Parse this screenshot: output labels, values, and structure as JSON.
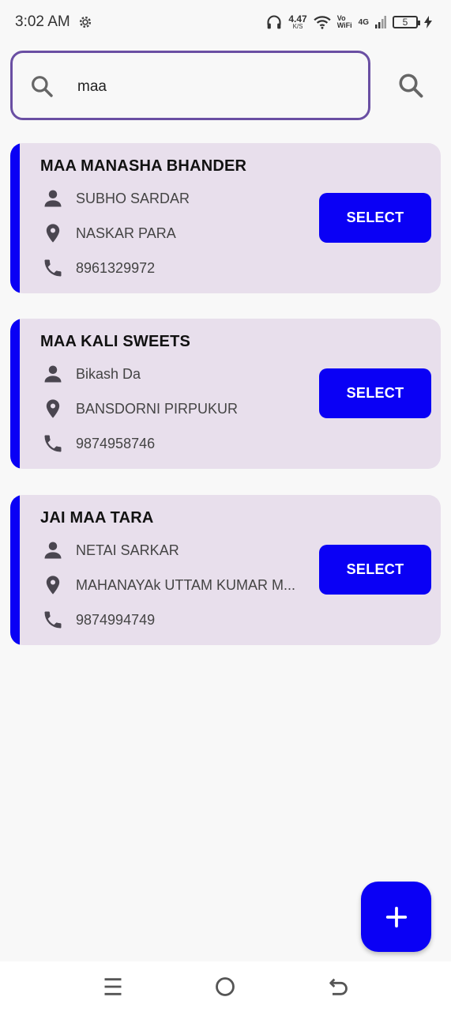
{
  "status_bar": {
    "time": "3:02 AM",
    "net_speed": "4.47",
    "net_speed_unit": "K/S",
    "vo": "Vo",
    "wifi": "WiFi",
    "network": "4G",
    "battery": "5"
  },
  "search": {
    "value": "maa",
    "placeholder": ""
  },
  "shops": [
    {
      "name": "MAA MANASHA BHANDER",
      "owner": "SUBHO SARDAR",
      "address": "NASKAR PARA",
      "phone": "8961329972",
      "select_label": "SELECT"
    },
    {
      "name": "MAA KALI SWEETS",
      "owner": "Bikash Da",
      "address": "BANSDORNI PIRPUKUR",
      "phone": "9874958746",
      "select_label": "SELECT"
    },
    {
      "name": "JAI MAA TARA",
      "owner": "NETAI SARKAR",
      "address": "MAHANAYAk UTTAM KUMAR M...",
      "phone": "9874994749",
      "select_label": "SELECT"
    }
  ],
  "colors": {
    "accent": "#0a00f5",
    "card_bg": "#e8dfec",
    "search_border": "#6a4fa3"
  },
  "icons": {
    "status": [
      "gear-icon",
      "headphones-icon",
      "wifi-icon",
      "signal-icon",
      "battery-icon",
      "charging-icon"
    ],
    "search": "search-icon",
    "card_rows": [
      "person-icon",
      "location-pin-icon",
      "phone-icon"
    ],
    "fab": "plus-icon",
    "nav": [
      "menu-icon",
      "home-icon",
      "back-icon"
    ]
  }
}
